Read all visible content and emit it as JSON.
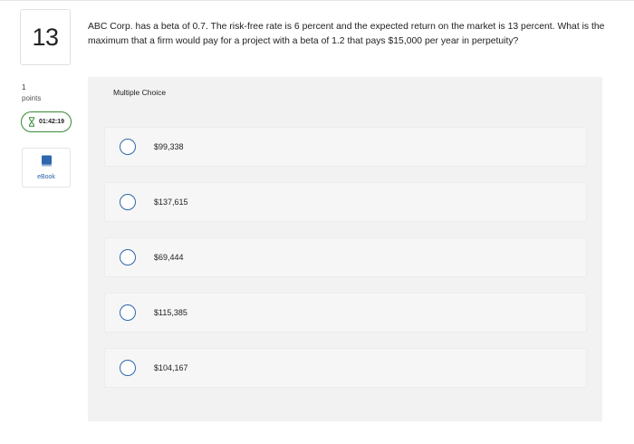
{
  "question": {
    "number": "13",
    "text": "ABC Corp. has a beta of 0.7. The risk-free rate is 6 percent and the expected return on the market is 13 percent. What is the maximum that a firm would pay for a project with a beta of 1.2 that pays $15,000 per year in perpetuity?"
  },
  "sidebar": {
    "points_value": "1",
    "points_label": "points",
    "timer": "01:42:19",
    "ebook_label": "eBook"
  },
  "multiple_choice": {
    "header": "Multiple Choice",
    "options": [
      {
        "label": "$99,338"
      },
      {
        "label": "$137,615"
      },
      {
        "label": "$69,444"
      },
      {
        "label": "$115,385"
      },
      {
        "label": "$104,167"
      }
    ]
  },
  "colors": {
    "accent": "#2d67ad",
    "timer_border": "#3a8a3a",
    "panel_bg": "#f2f2f2"
  },
  "icons": {
    "timer": "hourglass-icon",
    "ebook": "book-icon"
  }
}
